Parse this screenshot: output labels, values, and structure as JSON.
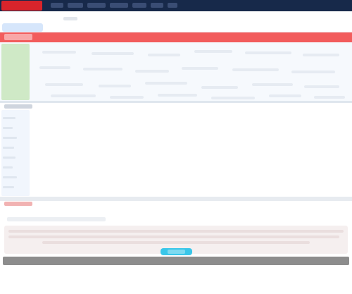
{
  "app": {
    "title": ""
  },
  "colors": {
    "navy": "#17294a",
    "brand_red": "#d9242b",
    "band_red": "#f25c5c",
    "accent_cyan": "#39c6e9",
    "green": "#cfe9c6",
    "footer_gray": "#8d8d8d"
  },
  "header": {
    "nav_items": [
      {
        "label": ""
      },
      {
        "label": ""
      },
      {
        "label": ""
      },
      {
        "label": ""
      },
      {
        "label": ""
      },
      {
        "label": ""
      },
      {
        "label": ""
      },
      {
        "label": ""
      }
    ],
    "active_tab_label": ""
  },
  "main": {
    "section_title": ""
  },
  "middle": {
    "section_title": ""
  },
  "bottom": {
    "section_title": "",
    "subtitle": "",
    "button_label": ""
  },
  "icons": {
    "logo": "brand-logo-icon"
  }
}
